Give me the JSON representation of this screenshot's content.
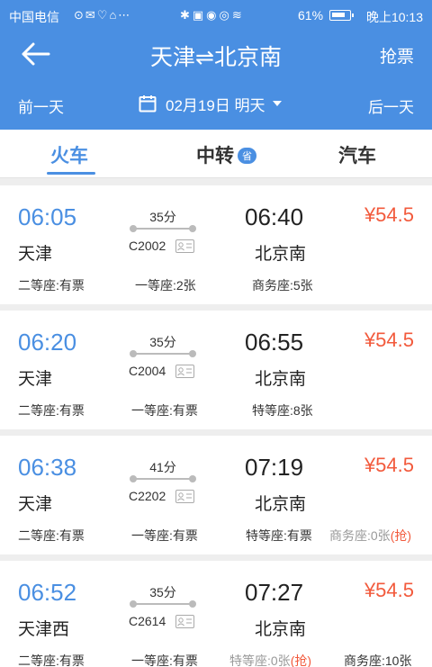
{
  "status_bar": {
    "carrier": "中国电信",
    "battery": "61%",
    "time": "晚上10:13"
  },
  "header": {
    "title": "天津⇌北京南",
    "grab_tickets": "抢票",
    "prev_day": "前一天",
    "date": "02月19日 明天",
    "next_day": "后一天"
  },
  "tabs": [
    {
      "label": "火车",
      "active": true
    },
    {
      "label": "中转",
      "badge": "省"
    },
    {
      "label": "汽车"
    }
  ],
  "trains": [
    {
      "dep_time": "06:05",
      "dep_station": "天津",
      "duration": "35分",
      "train_no": "C2002",
      "arr_time": "06:40",
      "arr_station": "北京南",
      "price": "¥54.5",
      "seats": [
        {
          "text": "二等座:有票"
        },
        {
          "text": "一等座:2张"
        },
        {
          "text": "商务座:5张"
        }
      ]
    },
    {
      "dep_time": "06:20",
      "dep_station": "天津",
      "duration": "35分",
      "train_no": "C2004",
      "arr_time": "06:55",
      "arr_station": "北京南",
      "price": "¥54.5",
      "seats": [
        {
          "text": "二等座:有票"
        },
        {
          "text": "一等座:有票"
        },
        {
          "text": "特等座:8张"
        }
      ]
    },
    {
      "dep_time": "06:38",
      "dep_station": "天津",
      "duration": "41分",
      "train_no": "C2202",
      "arr_time": "07:19",
      "arr_station": "北京南",
      "price": "¥54.5",
      "seats": [
        {
          "text": "二等座:有票"
        },
        {
          "text": "一等座:有票"
        },
        {
          "text": "特等座:有票"
        },
        {
          "text": "商务座:0张",
          "grab": "(抢)"
        }
      ]
    },
    {
      "dep_time": "06:52",
      "dep_station": "天津西",
      "duration": "35分",
      "train_no": "C2614",
      "arr_time": "07:27",
      "arr_station": "北京南",
      "price": "¥54.5",
      "seats": [
        {
          "text": "二等座:有票"
        },
        {
          "text": "一等座:有票"
        },
        {
          "text": "特等座:0张",
          "grab": "(抢)"
        },
        {
          "text": "商务座:10张"
        }
      ]
    }
  ]
}
